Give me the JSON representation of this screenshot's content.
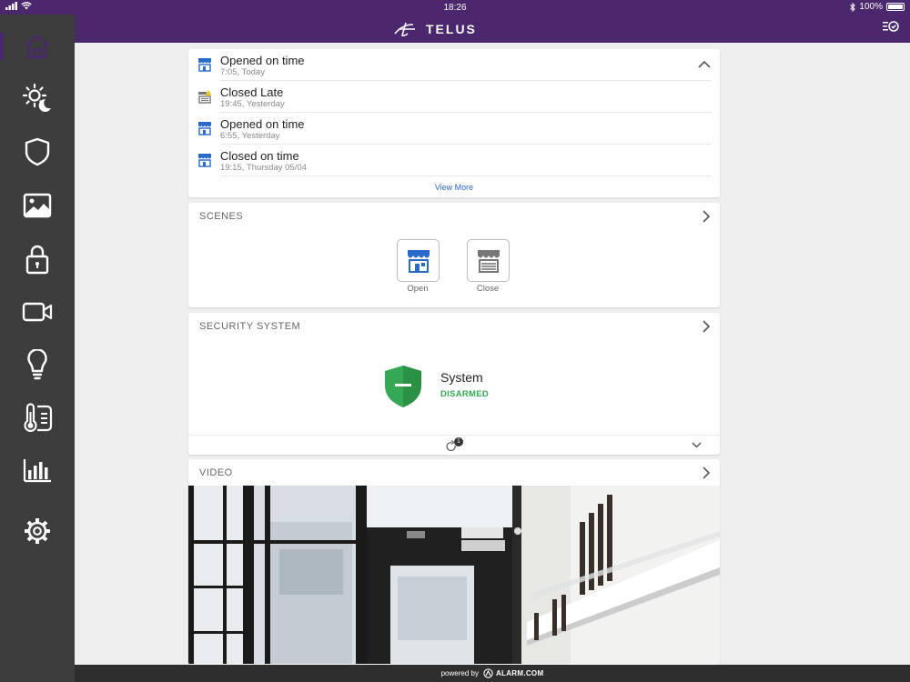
{
  "status_bar": {
    "time": "18:26",
    "battery": "100%"
  },
  "header": {
    "brand": "TELUS"
  },
  "sidebar": {
    "items": [
      {
        "icon": "home-icon"
      },
      {
        "icon": "sun-moon-icon"
      },
      {
        "icon": "shield-icon"
      },
      {
        "icon": "image-icon"
      },
      {
        "icon": "lock-icon"
      },
      {
        "icon": "video-camera-icon"
      },
      {
        "icon": "lightbulb-icon"
      },
      {
        "icon": "thermostat-icon"
      },
      {
        "icon": "bar-chart-icon"
      },
      {
        "icon": "gear-icon"
      }
    ]
  },
  "activity": {
    "events": [
      {
        "title": "Opened on time",
        "time": "7:05, Today"
      },
      {
        "title": "Closed Late",
        "time": "19:45, Yesterday"
      },
      {
        "title": "Opened on time",
        "time": "6:55, Yesterday"
      },
      {
        "title": "Closed on time",
        "time": "19:15, Thursday 05/04"
      }
    ],
    "view_more": "View More"
  },
  "scenes": {
    "title": "SCENES",
    "buttons": [
      {
        "label": "Open"
      },
      {
        "label": "Close"
      }
    ]
  },
  "security": {
    "title": "SECURITY SYSTEM",
    "system_label": "System",
    "status": "DISARMED",
    "badge_count": "1"
  },
  "video": {
    "title": "VIDEO"
  },
  "footer": {
    "powered_by": "powered by",
    "provider": "ALARM.COM"
  },
  "colors": {
    "brand_purple": "#4b286d",
    "sidebar": "#3d3d3d",
    "accent_blue": "#2a6ac8",
    "disarmed_green": "#34a853"
  }
}
